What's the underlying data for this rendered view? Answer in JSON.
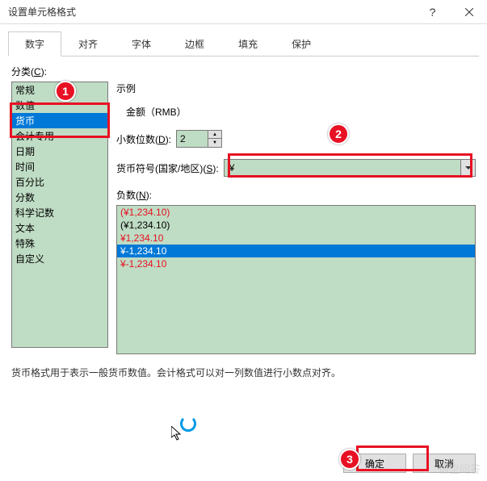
{
  "titlebar": {
    "title": "设置单元格格式"
  },
  "tabs": [
    "数字",
    "对齐",
    "字体",
    "边框",
    "填充",
    "保护"
  ],
  "category": {
    "label": "分类",
    "hotkey": "C",
    "items": [
      "常规",
      "数值",
      "货币",
      "会计专用",
      "日期",
      "时间",
      "百分比",
      "分数",
      "科学记数",
      "文本",
      "特殊",
      "自定义"
    ],
    "selected_index": 2
  },
  "example": {
    "label": "示例",
    "value": "金额（RMB）"
  },
  "decimal": {
    "label": "小数位数",
    "hotkey": "D",
    "value": "2"
  },
  "symbol": {
    "label": "货币符号(国家/地区)",
    "hotkey": "S",
    "value": "¥"
  },
  "negative": {
    "label": "负数",
    "hotkey": "N",
    "items": [
      {
        "text": "(¥1,234.10)",
        "color": "red"
      },
      {
        "text": "(¥1,234.10)",
        "color": "black"
      },
      {
        "text": "¥1,234.10",
        "color": "red"
      },
      {
        "text": "¥-1,234.10",
        "color": "selected"
      },
      {
        "text": "¥-1,234.10",
        "color": "red"
      }
    ]
  },
  "description": "货币格式用于表示一般货币数值。会计格式可以对一列数值进行小数点对齐。",
  "buttons": {
    "ok": "确定",
    "cancel": "取消"
  },
  "annotations": {
    "a1": "1",
    "a2": "2",
    "a3": "3"
  },
  "watermark": "悟空问答"
}
